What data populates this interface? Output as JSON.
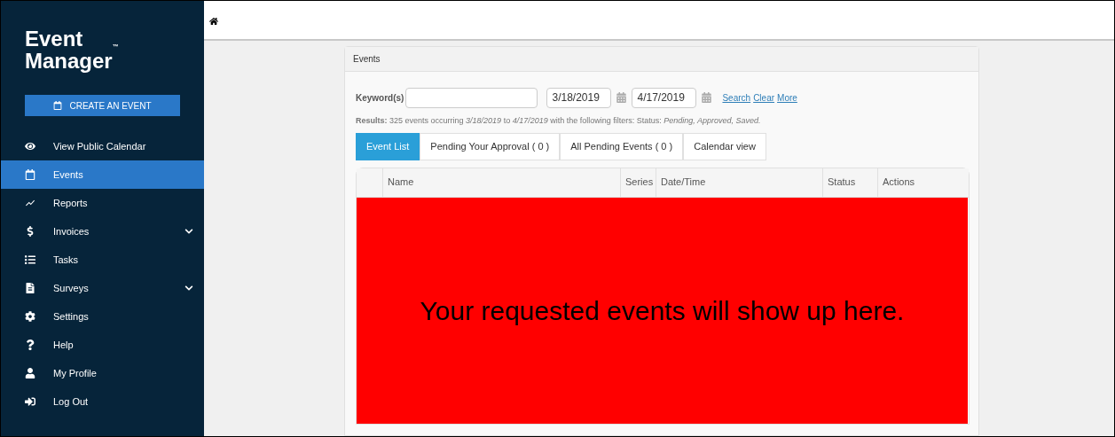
{
  "sidebar": {
    "logo": {
      "line1": "Event",
      "line2": "Manager",
      "mark": "™"
    },
    "create_button": "CREATE AN EVENT",
    "items": [
      {
        "label": "View Public Calendar",
        "selected": false,
        "has_submenu": false
      },
      {
        "label": "Events",
        "selected": true,
        "has_submenu": false
      },
      {
        "label": "Reports",
        "selected": false,
        "has_submenu": false
      },
      {
        "label": "Invoices",
        "selected": false,
        "has_submenu": true
      },
      {
        "label": "Tasks",
        "selected": false,
        "has_submenu": false
      },
      {
        "label": "Surveys",
        "selected": false,
        "has_submenu": true
      },
      {
        "label": "Settings",
        "selected": false,
        "has_submenu": false
      },
      {
        "label": "Help",
        "selected": false,
        "has_submenu": false
      },
      {
        "label": "My Profile",
        "selected": false,
        "has_submenu": false
      },
      {
        "label": "Log Out",
        "selected": false,
        "has_submenu": false
      }
    ]
  },
  "panel": {
    "title": "Events",
    "filters": {
      "keyword_label": "Keyword(s)",
      "start_date": "3/18/2019",
      "end_date": "4/17/2019",
      "links": [
        "Search",
        "Clear",
        "More"
      ]
    },
    "results": "**Results:** 325 events occurring *3/18/2019* to *4/17/2019* with the following filters: Status: *Pending, Approved, Saved.*",
    "tabs": [
      {
        "label": "Event List",
        "selected": true
      },
      {
        "label": "Pending Your Approval ( 0 )",
        "selected": false
      },
      {
        "label": "All Pending Events ( 0 )",
        "selected": false
      },
      {
        "label": "Calendar view",
        "selected": false
      }
    ],
    "table": {
      "columns": [
        "Name",
        "Series",
        "Date/Time",
        "Status",
        "Actions"
      ]
    },
    "overlay_message": "Your requested events will show up here."
  }
}
